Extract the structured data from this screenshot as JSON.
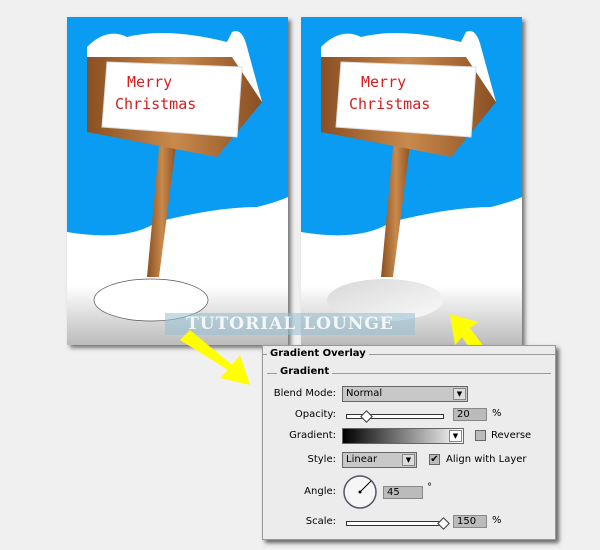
{
  "scene": {
    "sign_text_line1": "Merry",
    "sign_text_line2": "Christmas",
    "sky_color": "#0a9cf2",
    "watermark": "TUTORIAL LOUNGE"
  },
  "dialog": {
    "section_title": "Gradient Overlay",
    "group_title": "Gradient",
    "blend_mode": {
      "label": "Blend Mode:",
      "value": "Normal"
    },
    "opacity": {
      "label": "Opacity:",
      "value": "20",
      "unit": "%",
      "slider_percent": 20
    },
    "gradient": {
      "label": "Gradient:",
      "reverse_label": "Reverse",
      "reverse_checked": false
    },
    "style": {
      "label": "Style:",
      "value": "Linear",
      "align_label": "Align with Layer",
      "align_checked": true
    },
    "angle": {
      "label": "Angle:",
      "value": "45",
      "unit": "°"
    },
    "scale": {
      "label": "Scale:",
      "value": "150",
      "unit": "%",
      "slider_percent": 100
    }
  },
  "annotations": {
    "arrow_color": "#ffff00"
  }
}
